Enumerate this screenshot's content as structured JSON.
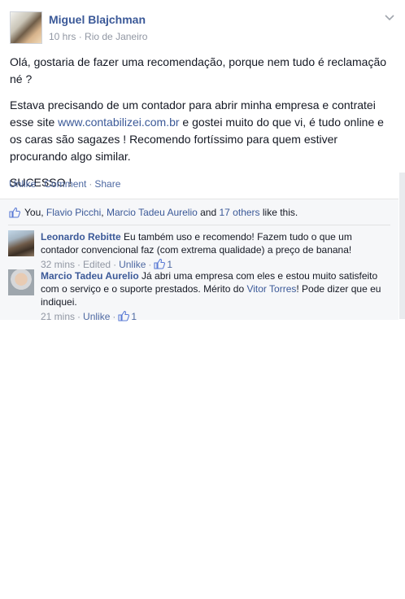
{
  "post": {
    "author": "Miguel Blajchman",
    "time": "10 hrs",
    "location": "Rio de Janeiro",
    "paragraphs": [
      "Olá, gostaria de fazer uma recomendação, porque nem tudo é reclamação né ?",
      {
        "before": "Estava precisando de um contador para abrir minha empresa e contratei esse site ",
        "link": "www.contabilizei.com.br",
        "after": " e gostei muito do que vi, é tudo online e os caras são sagazes ! Recomendo fortíssimo para quem estiver procurando algo similar."
      },
      "SUCESSO !"
    ],
    "actions": {
      "unlike": "Unlike",
      "comment": "Comment",
      "share": "Share"
    },
    "dot": "·"
  },
  "likes": {
    "you": "You",
    "sep1": ", ",
    "person1": "Flavio Picchi",
    "sep2": ", ",
    "person2": "Marcio Tadeu Aurelio",
    "and": " and ",
    "others": "17 others",
    "suffix": " like this."
  },
  "comments": [
    {
      "name": "Leonardo Rebitte",
      "text": "Eu também uso e recomendo! Fazem tudo o que um contador convencional faz (com extrema qualidade) a preço de banana!",
      "time": "32 mins",
      "edited": "Edited",
      "unlike": "Unlike",
      "likes": "1"
    },
    {
      "name": "Marcio Tadeu Aurelio",
      "text_before": "Já abri uma empresa com eles e estou muito satisfeito com o serviço e o suporte prestados. Mérito do ",
      "mention": "Vitor Torres",
      "text_after": "! Pode dizer que eu indiquei.",
      "time": "21 mins",
      "unlike": "Unlike",
      "likes": "1"
    }
  ],
  "colors": {
    "link": "#3b5998",
    "meta": "#9197a3",
    "feedback_bg": "#f6f7f9"
  }
}
